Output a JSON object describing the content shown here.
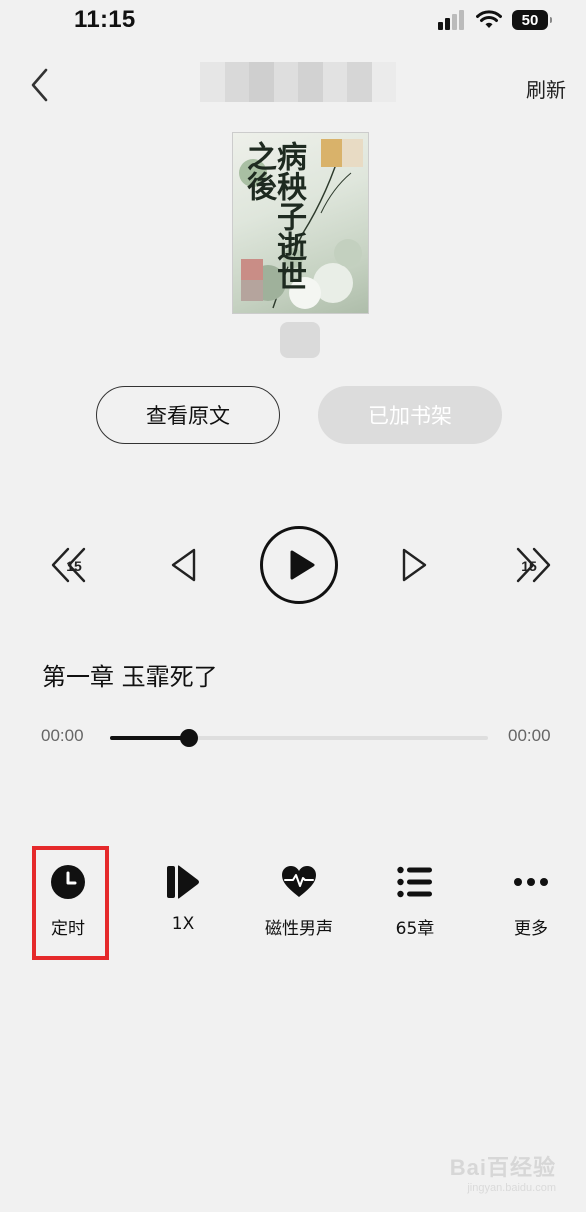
{
  "status_bar": {
    "time": "11:15",
    "battery": "50",
    "icons": [
      "cellular-signal-icon",
      "wifi-icon",
      "battery-icon"
    ]
  },
  "nav": {
    "back_icon": "chevron-left-icon",
    "refresh_label": "刷新"
  },
  "book": {
    "cover_title": "病秧子逝世之後"
  },
  "buttons": {
    "view_original": "查看原文",
    "added_to_shelf": "已加书架"
  },
  "player": {
    "rewind_seconds": "15",
    "forward_seconds": "15",
    "chapter_title": "第一章 玉霏死了",
    "current_time": "00:00",
    "total_time": "00:00",
    "progress": 0.21
  },
  "actions": [
    {
      "label": "定时",
      "icon": "clock-icon"
    },
    {
      "label": "1X",
      "icon": "speed-icon"
    },
    {
      "label": "磁性男声",
      "icon": "heart-pulse-icon"
    },
    {
      "label": "65章",
      "icon": "list-icon"
    },
    {
      "label": "更多",
      "icon": "more-dots-icon"
    }
  ],
  "colors": {
    "background": "#f1f1f1",
    "highlight": "#e5292b",
    "disabled_button": "#dcdcdc"
  },
  "watermark": {
    "brand": "Bai百经验",
    "domain": "jingyan.baidu.com"
  }
}
